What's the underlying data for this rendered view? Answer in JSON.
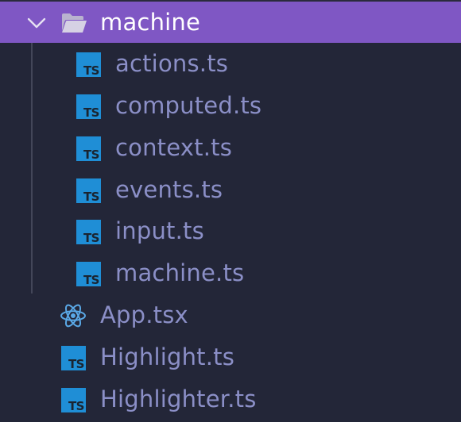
{
  "explorer": {
    "folder": {
      "name": "machine",
      "expanded": true,
      "selected": true,
      "icon": "folder-open-icon",
      "chevron_icon": "chevron-down-icon"
    },
    "folder_files": [
      {
        "name": "actions.ts",
        "icon": "typescript-icon",
        "badge": "TS"
      },
      {
        "name": "computed.ts",
        "icon": "typescript-icon",
        "badge": "TS"
      },
      {
        "name": "context.ts",
        "icon": "typescript-icon",
        "badge": "TS"
      },
      {
        "name": "events.ts",
        "icon": "typescript-icon",
        "badge": "TS"
      },
      {
        "name": "input.ts",
        "icon": "typescript-icon",
        "badge": "TS"
      },
      {
        "name": "machine.ts",
        "icon": "typescript-icon",
        "badge": "TS"
      }
    ],
    "root_files": [
      {
        "name": "App.tsx",
        "icon": "react-icon"
      },
      {
        "name": "Highlight.ts",
        "icon": "typescript-icon",
        "badge": "TS"
      },
      {
        "name": "Highlighter.ts",
        "icon": "typescript-icon",
        "badge": "TS"
      }
    ]
  },
  "colors": {
    "background": "#232638",
    "selection": "#7f57c4",
    "file_text": "#8b8fc7",
    "selected_text": "#ffffff",
    "ts_icon": "#1f8ed6",
    "react_icon": "#5aa8e6",
    "indent_guide": "#434659"
  }
}
